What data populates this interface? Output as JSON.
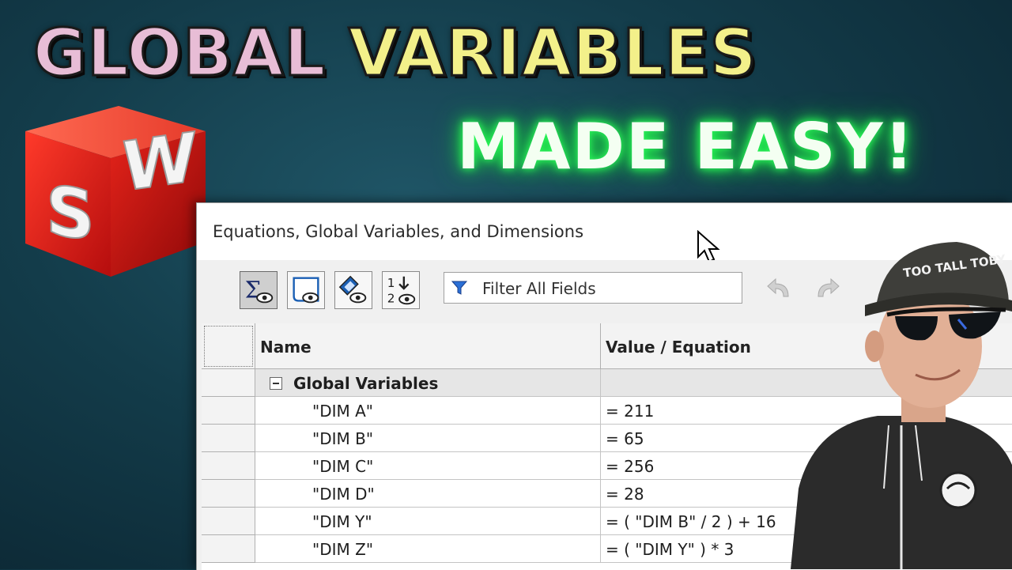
{
  "thumbnail": {
    "title_part1": "GLOBAL",
    "title_part2": "VARIABLES",
    "subtitle": "MADE EASY!",
    "colors": {
      "part1": "#e8bdd6",
      "part2": "#f3f08a",
      "subtitle_glow": "#2cff5a"
    }
  },
  "logo": {
    "icon": "solidworks-logo-icon",
    "letters": "SW"
  },
  "dialog": {
    "title": "Equations, Global Variables, and Dimensions",
    "toolbar": {
      "buttons": [
        {
          "icon": "equation-view-icon",
          "active": true
        },
        {
          "icon": "sketch-equation-view-icon",
          "active": false
        },
        {
          "icon": "dimension-view-icon",
          "active": false
        },
        {
          "icon": "ordered-view-icon",
          "active": false
        }
      ],
      "filter_placeholder": "Filter All Fields",
      "undo_icon": "undo-icon",
      "redo_icon": "redo-icon"
    },
    "table": {
      "columns": [
        "Name",
        "Value / Equation"
      ],
      "group": "Global Variables",
      "rows": [
        {
          "name": "\"DIM A\"",
          "value": "= 211"
        },
        {
          "name": "\"DIM B\"",
          "value": "= 65"
        },
        {
          "name": "\"DIM C\"",
          "value": "= 256"
        },
        {
          "name": "\"DIM D\"",
          "value": "= 28"
        },
        {
          "name": "\"DIM Y\"",
          "value": "= ( \"DIM B\" / 2 ) + 16"
        },
        {
          "name": "\"DIM Z\"",
          "value": "= ( \"DIM Y\" ) * 3"
        }
      ]
    }
  },
  "presenter": {
    "cap_text": "TOO TALL TOBY"
  }
}
